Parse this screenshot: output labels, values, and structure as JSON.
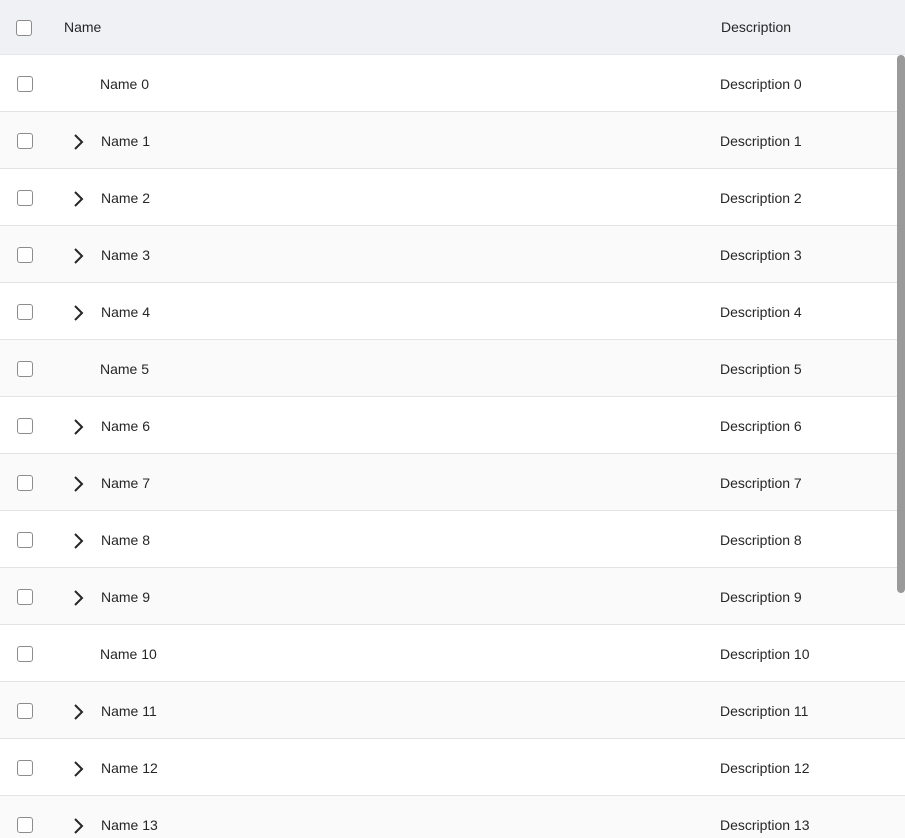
{
  "header": {
    "name_label": "Name",
    "description_label": "Description"
  },
  "rows": [
    {
      "name": "Name 0",
      "description": "Description 0",
      "expandable": false
    },
    {
      "name": "Name 1",
      "description": "Description 1",
      "expandable": true
    },
    {
      "name": "Name 2",
      "description": "Description 2",
      "expandable": true
    },
    {
      "name": "Name 3",
      "description": "Description 3",
      "expandable": true
    },
    {
      "name": "Name 4",
      "description": "Description 4",
      "expandable": true
    },
    {
      "name": "Name 5",
      "description": "Description 5",
      "expandable": false
    },
    {
      "name": "Name 6",
      "description": "Description 6",
      "expandable": true
    },
    {
      "name": "Name 7",
      "description": "Description 7",
      "expandable": true
    },
    {
      "name": "Name 8",
      "description": "Description 8",
      "expandable": true
    },
    {
      "name": "Name 9",
      "description": "Description 9",
      "expandable": true
    },
    {
      "name": "Name 10",
      "description": "Description 10",
      "expandable": false
    },
    {
      "name": "Name 11",
      "description": "Description 11",
      "expandable": true
    },
    {
      "name": "Name 12",
      "description": "Description 12",
      "expandable": true
    },
    {
      "name": "Name 13",
      "description": "Description 13",
      "expandable": true
    }
  ],
  "icons": {
    "expander": "chevron-right-icon",
    "checkbox": "checkbox-unchecked"
  },
  "colors": {
    "header_bg": "#f0f1f5",
    "row_alt_bg": "#fafafa",
    "scrollbar": "#9a9a9a"
  }
}
